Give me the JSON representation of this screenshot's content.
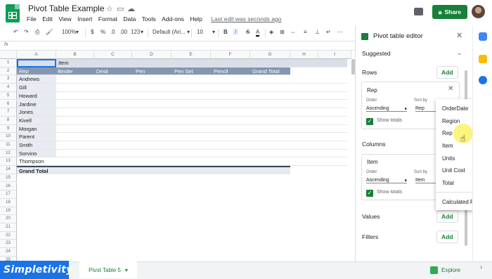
{
  "app": {
    "doc_title": "Pivot Table Example",
    "last_edit": "Last edit was seconds ago",
    "share_label": "Share"
  },
  "menu": [
    "File",
    "Edit",
    "View",
    "Insert",
    "Format",
    "Data",
    "Tools",
    "Add-ons",
    "Help"
  ],
  "toolbar": {
    "zoom": "100%",
    "currency": "$",
    "percent": "%",
    "dec_less": ".0",
    "dec_more": ".00",
    "more_formats": "123",
    "font": "Default (Ari...",
    "font_size": "10",
    "bold": "B",
    "italic": "I",
    "strike": "S",
    "text_color": "A"
  },
  "grid": {
    "columns": [
      "A",
      "B",
      "C",
      "D",
      "E",
      "F",
      "G",
      "H",
      "I"
    ],
    "row_numbers": [
      "1",
      "2",
      "3",
      "4",
      "5",
      "6",
      "7",
      "8",
      "9",
      "10",
      "11",
      "12",
      "13",
      "14",
      "15",
      "16",
      "17",
      "18",
      "19",
      "20",
      "21",
      "22",
      "23",
      "24",
      "25"
    ],
    "item_header": "Item",
    "rep_header": "Rep",
    "col_headers": [
      "Binder",
      "Desk",
      "Pen",
      "Pen Set",
      "Pencil",
      "Grand Total"
    ],
    "reps": [
      "Andrews",
      "Gill",
      "Howard",
      "Jardine",
      "Jones",
      "Kivell",
      "Morgan",
      "Parent",
      "Smith",
      "Sorvino",
      "Thompson"
    ],
    "grand_total": "Grand Total"
  },
  "bottom": {
    "brand": "Simpletivity",
    "sheet_tab": "Pivot Table 5",
    "explore": "Explore"
  },
  "panel": {
    "title": "Pivot table editor",
    "suggested": "Suggested",
    "rows_label": "Rows",
    "add": "Add",
    "rows_card": {
      "title": "Rep",
      "order_label": "Order",
      "order_value": "Ascending",
      "sort_label": "Sort by",
      "sort_value": "Rep",
      "show_totals": "Show totals"
    },
    "columns_label": "Columns",
    "columns_card": {
      "title": "Item",
      "order_label": "Order",
      "order_value": "Ascending",
      "sort_label": "Sort by",
      "sort_value": "Item",
      "show_totals": "Show totals"
    },
    "values_label": "Values",
    "filters_label": "Filters"
  },
  "dropdown": [
    "OrderDate",
    "Region",
    "Rep",
    "Item",
    "Units",
    "Unit Cost",
    "Total",
    "Calculated Field"
  ],
  "colors": {
    "brand_green": "#188038",
    "header_fill": "#8497b0",
    "brand_blue": "#1a73e8"
  }
}
